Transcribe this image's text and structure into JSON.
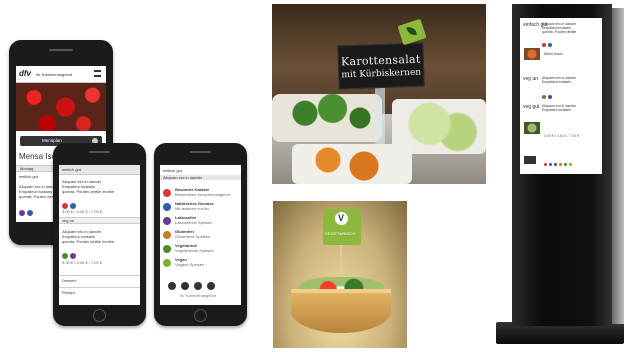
{
  "phone1": {
    "brand": "dfv",
    "app_title": "Ihr Kantinenangebot",
    "button_label": "Menüplan",
    "section_title": "Mensa Ische",
    "day": "Montag",
    "item_title": "smilich gut",
    "item_lines": [
      "Aliquam ero in dander",
      "Empalieui incisaris",
      "quenta. Pouten dertile imolhe"
    ]
  },
  "phone2": {
    "header": "smilich gut",
    "lines": [
      "Aliquam ero in dander",
      "Empalieui incisaris",
      "quenta. Pouten dertile imolhe"
    ],
    "price1": "3.00 € / 4.40 € / 7.00 €",
    "sub": "veg an",
    "lines2": [
      "Aliquam ero in dander",
      "Empalieui incisaris",
      "quenta. Pouten dertile imolhe"
    ],
    "price2": "3.00 € / 4.40 € / 7.00 €",
    "footer1": "Dessert",
    "footer2": "Rezept"
  },
  "phone3": {
    "top1": "smilich gut",
    "top2": "Aliquam ero in dander",
    "legend": [
      {
        "title": "Besonder Kantine",
        "sub": "Besonderes Vorsprechangebot",
        "color": "#d23a3a"
      },
      {
        "title": "Natürliches Gemüse",
        "sub": "Mit anderen nur bio",
        "color": "#2c5fa8"
      },
      {
        "title": "Laktosefrei",
        "sub": "Laktosefreie Speisen",
        "color": "#6b3a8c"
      },
      {
        "title": "Glutenfrei",
        "sub": "Glutenfreie Speisen",
        "color": "#d07a1f"
      },
      {
        "title": "Vegetarisch",
        "sub": "Vegetarische Speisen",
        "color": "#4c8a2a"
      },
      {
        "title": "Vegan",
        "sub": "Vegane Speisen",
        "color": "#7ab532"
      }
    ],
    "footer": "Ihr Kantinenangebot"
  },
  "salad": {
    "sign_line1": "Karottensalat",
    "sign_line2": "mit Kürbiskernen"
  },
  "tart": {
    "flag_text": "VEGETARISCH"
  },
  "kiosk": {
    "block1": "einfach gut",
    "block2": "veg an",
    "block3": "veg gut",
    "lines": [
      "Aliquam ero in dander",
      "Empalieui incisaris",
      "quenta. Pouten dertile"
    ],
    "item_label": "Menü Ursen",
    "price": "3.00 € / 4.40 € / 7.00 €"
  },
  "colors": {
    "accent_green": "#8db83d",
    "phone_body": "#1b1b1b",
    "kiosk_body": "#0c0c0c"
  }
}
